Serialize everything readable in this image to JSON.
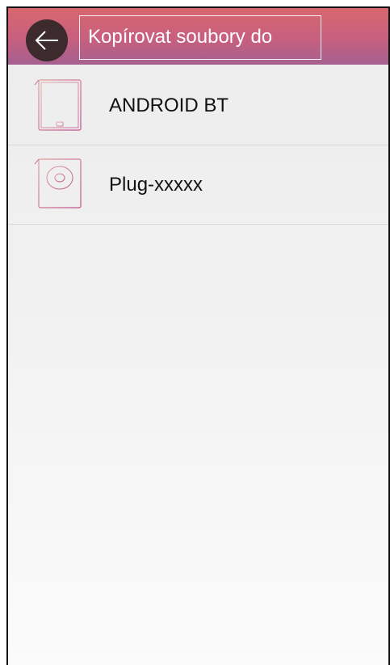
{
  "header": {
    "title": "Kopírovat soubory do",
    "back_icon": "arrow-left-icon"
  },
  "devices": [
    {
      "label": "ANDROID BT",
      "icon": "tablet-icon"
    },
    {
      "label": "Plug-xxxxx",
      "icon": "disk-drive-icon"
    }
  ],
  "colors": {
    "header_gradient_top": "#d8686e",
    "header_gradient_bottom": "#a56190",
    "back_button": "#3d2a2c",
    "icon_stroke": "#d06a7e"
  }
}
